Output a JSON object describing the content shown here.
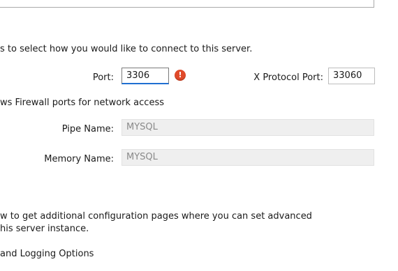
{
  "connectivity": {
    "intro_text": "s to select how you would like to connect to this server.",
    "port_label": "Port:",
    "port_value": "3306",
    "x_protocol_label": "X Protocol Port:",
    "x_protocol_value": "33060",
    "firewall_label": "ws Firewall ports for network access",
    "pipe_label": "Pipe Name:",
    "pipe_value": "MYSQL",
    "memory_label": "Memory Name:",
    "memory_value": "MYSQL"
  },
  "advanced": {
    "text_line1": "w to get additional configuration pages where you can set advanced",
    "text_line2": "his server instance.",
    "logging_label": "and Logging Options"
  },
  "colors": {
    "error_icon": "#e04a2a",
    "focus_underline": "#1f6fd1"
  },
  "icons": {
    "port_error": "error-icon"
  }
}
